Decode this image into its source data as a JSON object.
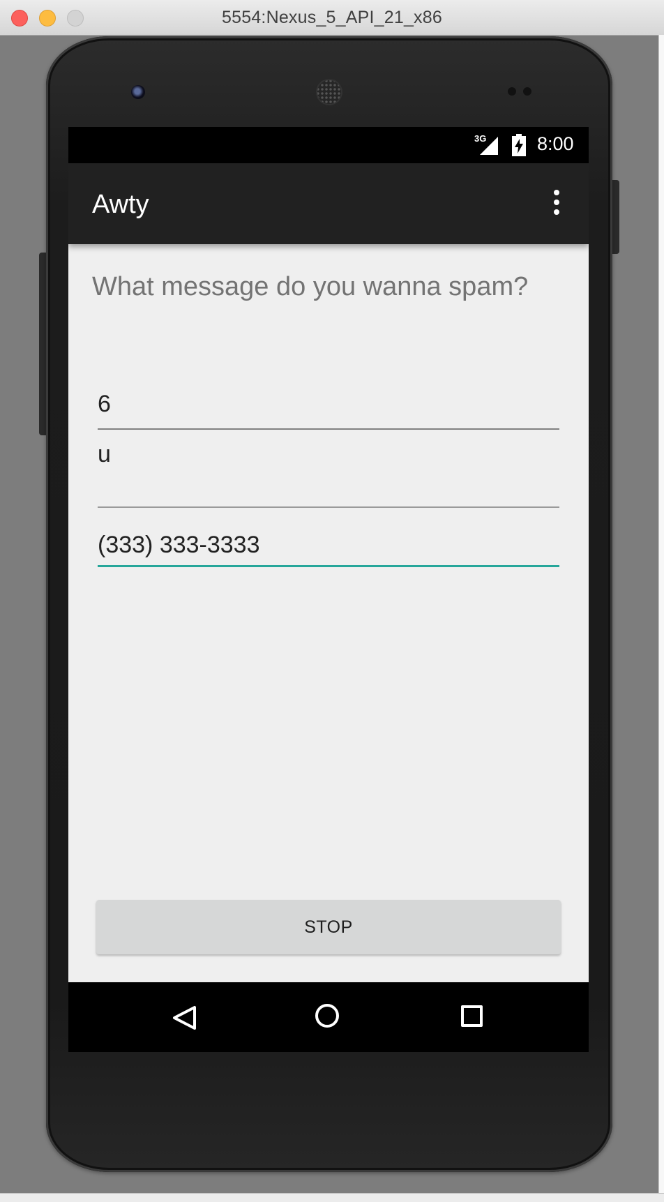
{
  "window": {
    "title": "5554:Nexus_5_API_21_x86"
  },
  "statusbar": {
    "network": "3G",
    "time": "8:00"
  },
  "appbar": {
    "title": "Awty",
    "menu_icon": "more-vert-icon"
  },
  "main": {
    "prompt": "What message do you wanna spam?",
    "fields": [
      {
        "value": "6"
      },
      {
        "value": "u"
      },
      {
        "value": "(333) 333-3333"
      }
    ],
    "stop_label": "STOP"
  },
  "navbar": {
    "icons": [
      "back-icon",
      "home-icon",
      "recents-icon"
    ]
  },
  "colors": {
    "accent": "#26a69a",
    "appbar": "#212121",
    "screen_bg": "#efefef"
  }
}
